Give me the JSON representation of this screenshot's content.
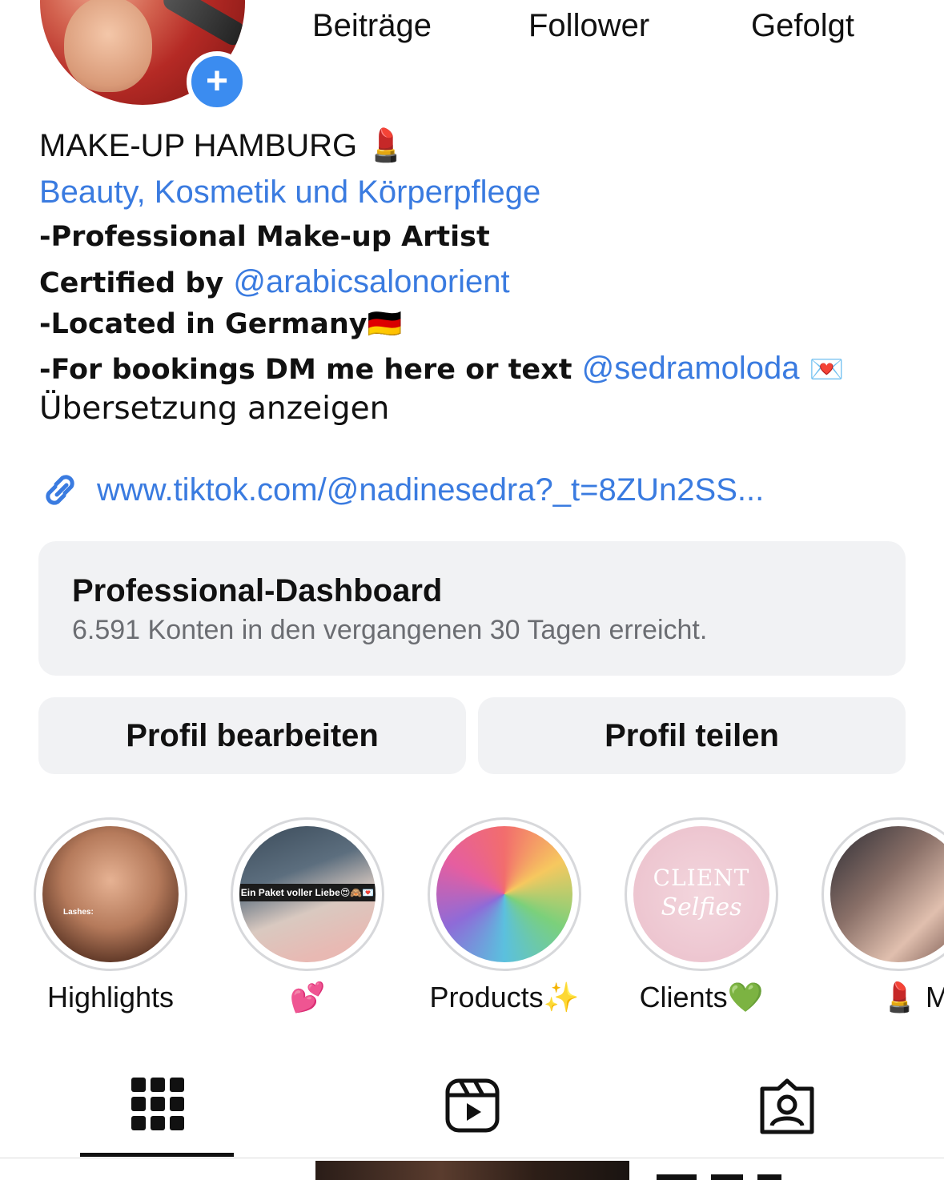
{
  "profile": {
    "add_icon": "plus-icon"
  },
  "stats": {
    "posts_label": "Beiträge",
    "followers_label": "Follower",
    "following_label": "Gefolgt"
  },
  "bio": {
    "name": "MAKE-UP HAMBURG 💄",
    "category": "Beauty, Kosmetik und Körperpflege",
    "line1": "-Professional Make-up Artist",
    "line2_prefix": "Certified by ",
    "line2_mention": "@arabicsalonorient",
    "line3": "-Located in Germany🇩🇪",
    "line4_prefix": "-For bookings DM me here or text ",
    "line4_mention": "@sedramoloda",
    "line4_suffix": " 💌",
    "translate": "Übersetzung anzeigen",
    "link": "www.tiktok.com/@nadinesedra?_t=8ZUn2SS..."
  },
  "dashboard": {
    "title": "Professional-Dashboard",
    "subtitle": "6.591 Konten in den vergangenen 30 Tagen erreicht."
  },
  "buttons": {
    "edit": "Profil bearbeiten",
    "share": "Profil teilen"
  },
  "highlights": [
    {
      "label": "Highlights",
      "overlay": "Lashes:"
    },
    {
      "label": "💕",
      "overlay": "Ein Paket voller Liebe😍🙈💌"
    },
    {
      "label": "Products✨"
    },
    {
      "label": "Clients💚",
      "overlay_title": "CLIENT",
      "overlay_script": "Selfies"
    },
    {
      "label": "💄 Me"
    }
  ],
  "tabs": [
    {
      "icon": "grid-icon",
      "active": true
    },
    {
      "icon": "reels-icon",
      "active": false
    },
    {
      "icon": "tagged-icon",
      "active": false
    }
  ],
  "colors": {
    "link": "#3a7be0",
    "add_button": "#3b8cf0",
    "card_bg": "#f1f2f4"
  }
}
